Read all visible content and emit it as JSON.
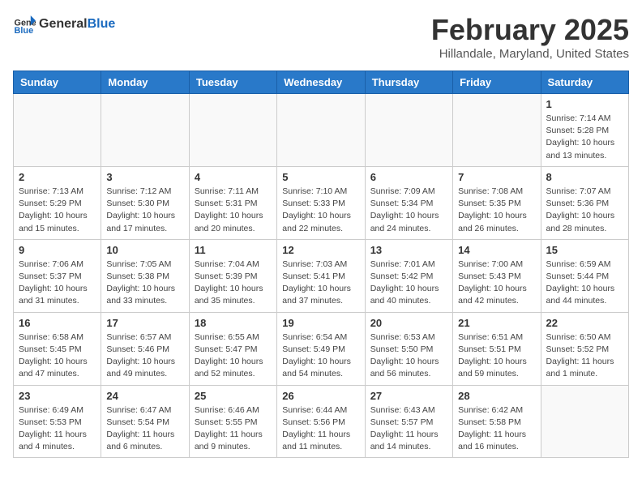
{
  "header": {
    "logo_general": "General",
    "logo_blue": "Blue",
    "month": "February 2025",
    "location": "Hillandale, Maryland, United States"
  },
  "weekdays": [
    "Sunday",
    "Monday",
    "Tuesday",
    "Wednesday",
    "Thursday",
    "Friday",
    "Saturday"
  ],
  "weeks": [
    [
      {
        "day": "",
        "info": ""
      },
      {
        "day": "",
        "info": ""
      },
      {
        "day": "",
        "info": ""
      },
      {
        "day": "",
        "info": ""
      },
      {
        "day": "",
        "info": ""
      },
      {
        "day": "",
        "info": ""
      },
      {
        "day": "1",
        "info": "Sunrise: 7:14 AM\nSunset: 5:28 PM\nDaylight: 10 hours\nand 13 minutes."
      }
    ],
    [
      {
        "day": "2",
        "info": "Sunrise: 7:13 AM\nSunset: 5:29 PM\nDaylight: 10 hours\nand 15 minutes."
      },
      {
        "day": "3",
        "info": "Sunrise: 7:12 AM\nSunset: 5:30 PM\nDaylight: 10 hours\nand 17 minutes."
      },
      {
        "day": "4",
        "info": "Sunrise: 7:11 AM\nSunset: 5:31 PM\nDaylight: 10 hours\nand 20 minutes."
      },
      {
        "day": "5",
        "info": "Sunrise: 7:10 AM\nSunset: 5:33 PM\nDaylight: 10 hours\nand 22 minutes."
      },
      {
        "day": "6",
        "info": "Sunrise: 7:09 AM\nSunset: 5:34 PM\nDaylight: 10 hours\nand 24 minutes."
      },
      {
        "day": "7",
        "info": "Sunrise: 7:08 AM\nSunset: 5:35 PM\nDaylight: 10 hours\nand 26 minutes."
      },
      {
        "day": "8",
        "info": "Sunrise: 7:07 AM\nSunset: 5:36 PM\nDaylight: 10 hours\nand 28 minutes."
      }
    ],
    [
      {
        "day": "9",
        "info": "Sunrise: 7:06 AM\nSunset: 5:37 PM\nDaylight: 10 hours\nand 31 minutes."
      },
      {
        "day": "10",
        "info": "Sunrise: 7:05 AM\nSunset: 5:38 PM\nDaylight: 10 hours\nand 33 minutes."
      },
      {
        "day": "11",
        "info": "Sunrise: 7:04 AM\nSunset: 5:39 PM\nDaylight: 10 hours\nand 35 minutes."
      },
      {
        "day": "12",
        "info": "Sunrise: 7:03 AM\nSunset: 5:41 PM\nDaylight: 10 hours\nand 37 minutes."
      },
      {
        "day": "13",
        "info": "Sunrise: 7:01 AM\nSunset: 5:42 PM\nDaylight: 10 hours\nand 40 minutes."
      },
      {
        "day": "14",
        "info": "Sunrise: 7:00 AM\nSunset: 5:43 PM\nDaylight: 10 hours\nand 42 minutes."
      },
      {
        "day": "15",
        "info": "Sunrise: 6:59 AM\nSunset: 5:44 PM\nDaylight: 10 hours\nand 44 minutes."
      }
    ],
    [
      {
        "day": "16",
        "info": "Sunrise: 6:58 AM\nSunset: 5:45 PM\nDaylight: 10 hours\nand 47 minutes."
      },
      {
        "day": "17",
        "info": "Sunrise: 6:57 AM\nSunset: 5:46 PM\nDaylight: 10 hours\nand 49 minutes."
      },
      {
        "day": "18",
        "info": "Sunrise: 6:55 AM\nSunset: 5:47 PM\nDaylight: 10 hours\nand 52 minutes."
      },
      {
        "day": "19",
        "info": "Sunrise: 6:54 AM\nSunset: 5:49 PM\nDaylight: 10 hours\nand 54 minutes."
      },
      {
        "day": "20",
        "info": "Sunrise: 6:53 AM\nSunset: 5:50 PM\nDaylight: 10 hours\nand 56 minutes."
      },
      {
        "day": "21",
        "info": "Sunrise: 6:51 AM\nSunset: 5:51 PM\nDaylight: 10 hours\nand 59 minutes."
      },
      {
        "day": "22",
        "info": "Sunrise: 6:50 AM\nSunset: 5:52 PM\nDaylight: 11 hours\nand 1 minute."
      }
    ],
    [
      {
        "day": "23",
        "info": "Sunrise: 6:49 AM\nSunset: 5:53 PM\nDaylight: 11 hours\nand 4 minutes."
      },
      {
        "day": "24",
        "info": "Sunrise: 6:47 AM\nSunset: 5:54 PM\nDaylight: 11 hours\nand 6 minutes."
      },
      {
        "day": "25",
        "info": "Sunrise: 6:46 AM\nSunset: 5:55 PM\nDaylight: 11 hours\nand 9 minutes."
      },
      {
        "day": "26",
        "info": "Sunrise: 6:44 AM\nSunset: 5:56 PM\nDaylight: 11 hours\nand 11 minutes."
      },
      {
        "day": "27",
        "info": "Sunrise: 6:43 AM\nSunset: 5:57 PM\nDaylight: 11 hours\nand 14 minutes."
      },
      {
        "day": "28",
        "info": "Sunrise: 6:42 AM\nSunset: 5:58 PM\nDaylight: 11 hours\nand 16 minutes."
      },
      {
        "day": "",
        "info": ""
      }
    ]
  ]
}
